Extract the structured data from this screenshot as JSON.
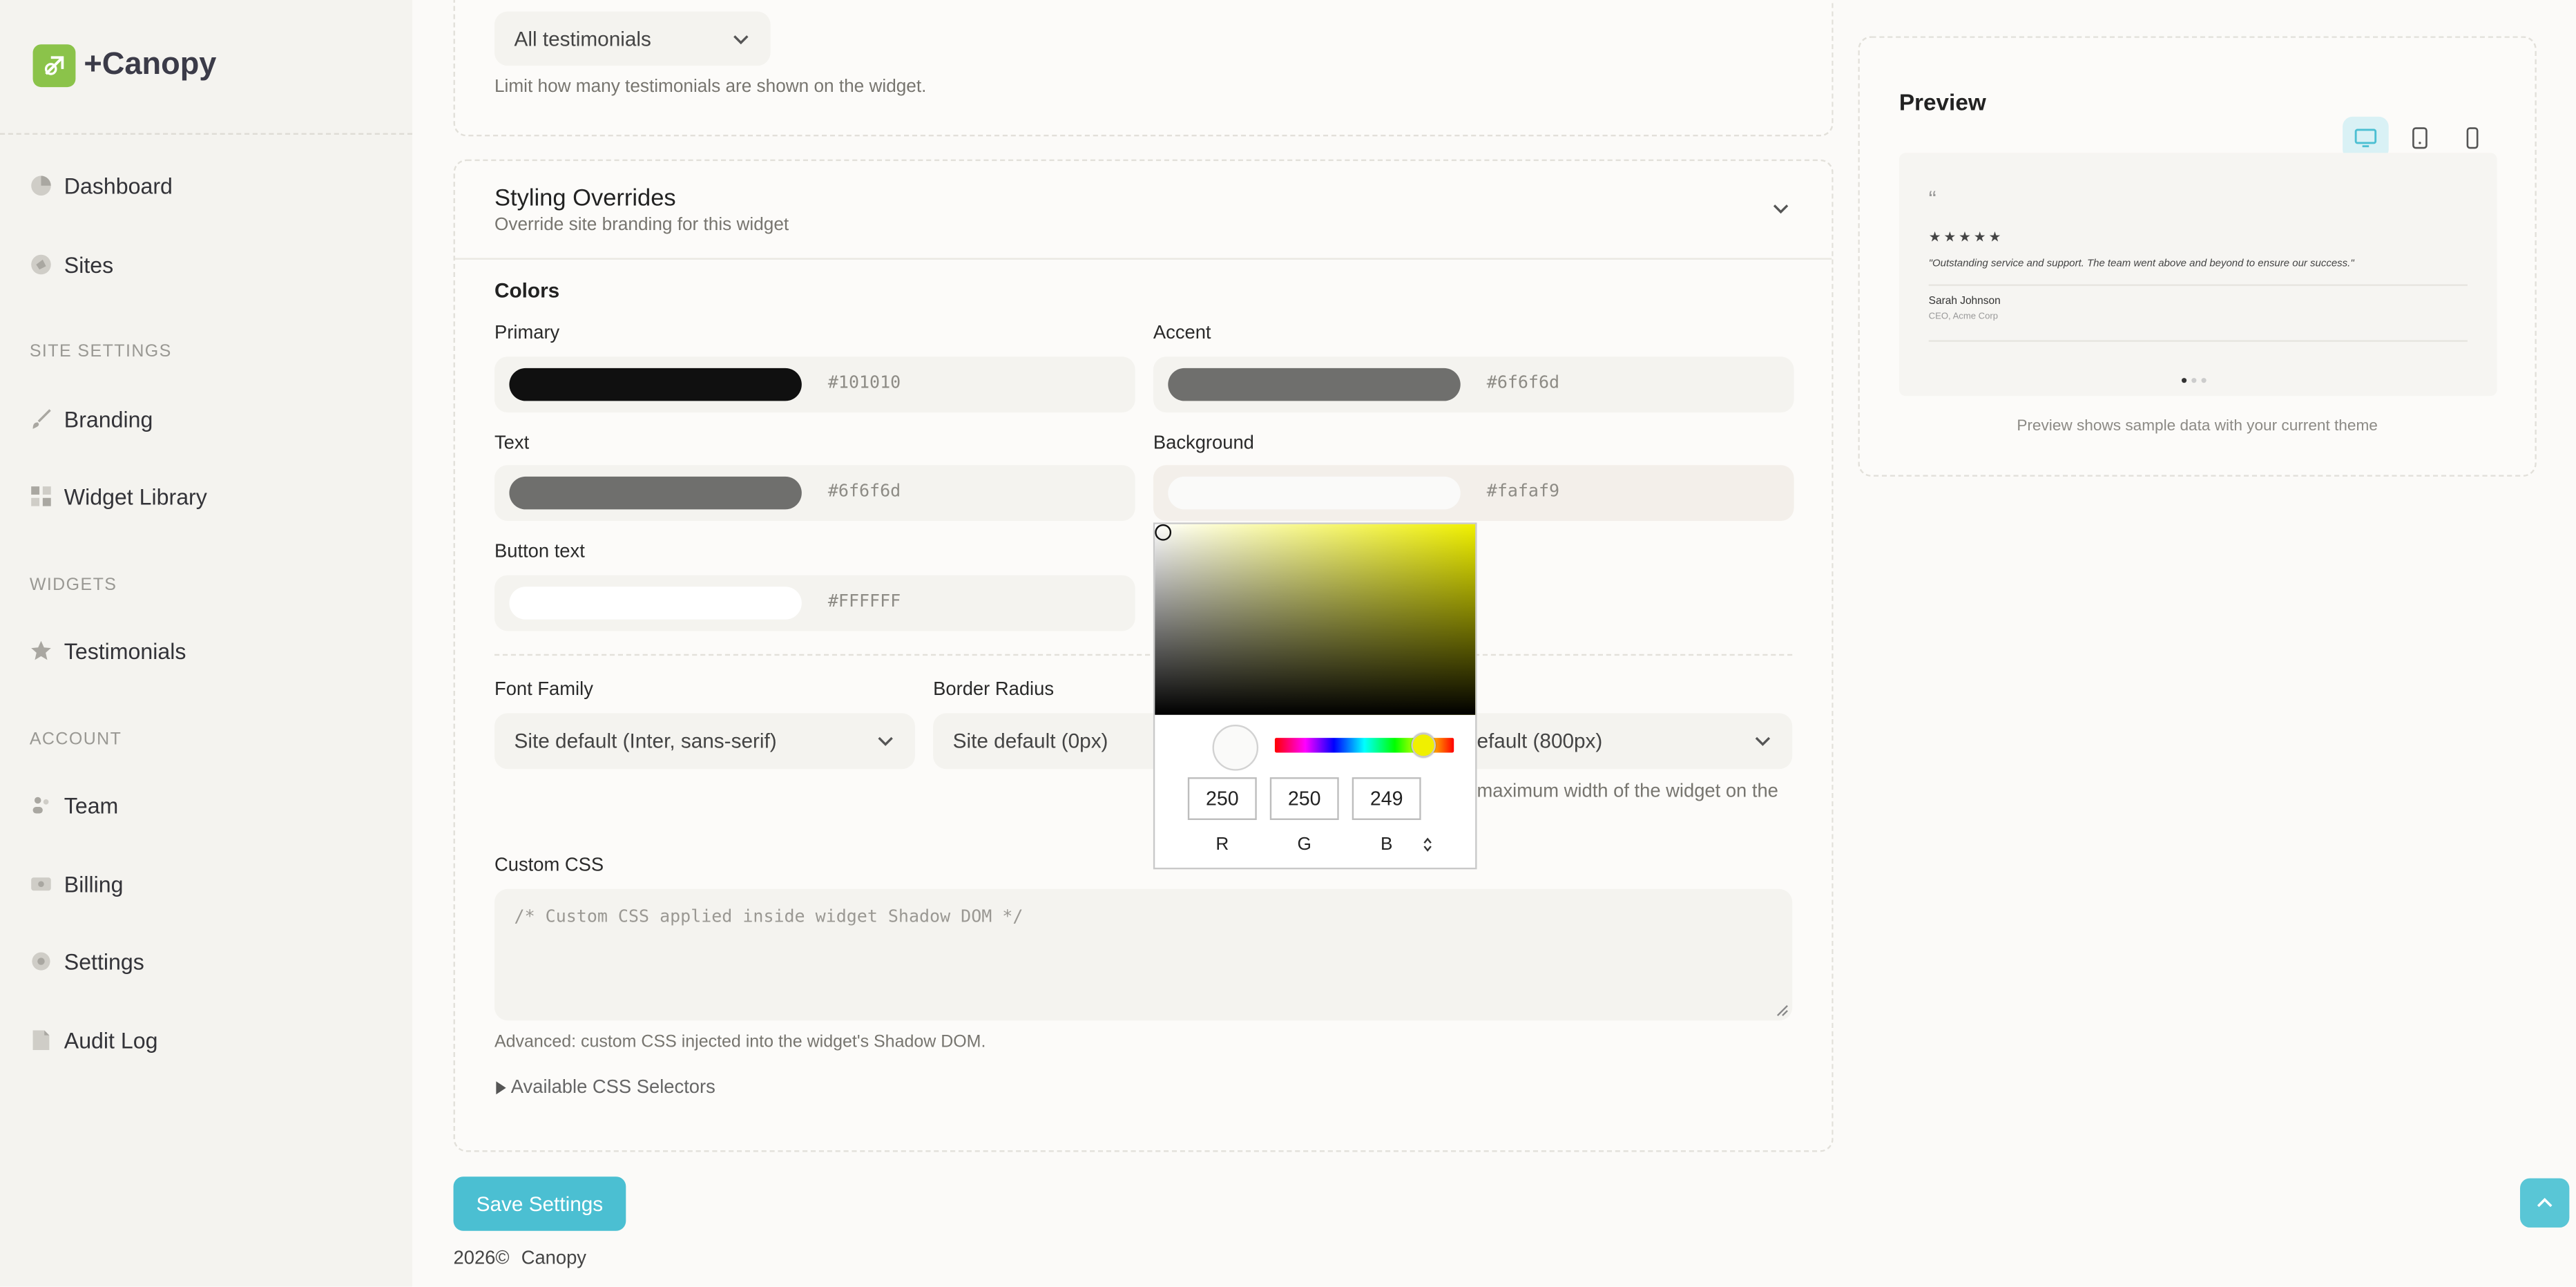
{
  "app": {
    "name": "+Canopy"
  },
  "sidebar": {
    "items": [
      {
        "label": "Dashboard"
      },
      {
        "label": "Sites"
      },
      {
        "label": "Branding"
      },
      {
        "label": "Widget Library"
      },
      {
        "label": "Testimonials"
      },
      {
        "label": "Team"
      },
      {
        "label": "Billing"
      },
      {
        "label": "Settings"
      },
      {
        "label": "Audit Log"
      }
    ],
    "sections": {
      "site_settings": "SITE SETTINGS",
      "widgets": "WIDGETS",
      "account": "ACCOUNT"
    }
  },
  "limit": {
    "select_value": "All testimonials",
    "help": "Limit how many testimonials are shown on the widget."
  },
  "styling": {
    "title": "Styling Overrides",
    "subtitle": "Override site branding for this widget",
    "colors_heading": "Colors",
    "colors": [
      {
        "label": "Primary",
        "hex": "#101010",
        "color": "#101010"
      },
      {
        "label": "Accent",
        "hex": "#6f6f6d",
        "color": "#6f6f6d"
      },
      {
        "label": "Text",
        "hex": "#6f6f6d",
        "color": "#6f6f6d"
      },
      {
        "label": "Background",
        "hex": "#fafaf9",
        "color": "#fafaf9"
      },
      {
        "label": "Button text",
        "hex": "#FFFFFF",
        "color": "#FFFFFF"
      }
    ],
    "font_family": {
      "label": "Font Family",
      "value": "Site default (Inter, sans-serif)"
    },
    "border_radius": {
      "label": "Border Radius",
      "value": "Site default (0px)"
    },
    "max_width": {
      "value_partial": "efault (800px)",
      "help_partial": "maximum width of the widget on the"
    },
    "custom_css": {
      "label": "Custom CSS",
      "placeholder": "/* Custom CSS applied inside widget Shadow DOM */",
      "help": "Advanced: custom CSS injected into the widget's Shadow DOM."
    },
    "selectors_toggle": "Available CSS Selectors"
  },
  "color_picker": {
    "r": "250",
    "g": "250",
    "b": "249",
    "labels": {
      "r": "R",
      "g": "G",
      "b": "B"
    }
  },
  "save_label": "Save Settings",
  "footer": {
    "year": "2026©",
    "brand": "Canopy"
  },
  "preview": {
    "title": "Preview",
    "quote_mark": "“",
    "stars": "★★★★★",
    "quote": "\"Outstanding service and support. The team went above and beyond to ensure our success.\"",
    "author": "Sarah Johnson",
    "role": "CEO, Acme Corp",
    "note": "Preview shows sample data with your current theme"
  },
  "colors": {
    "accent": "#4bbfd2",
    "logo": "#8bc34a"
  }
}
